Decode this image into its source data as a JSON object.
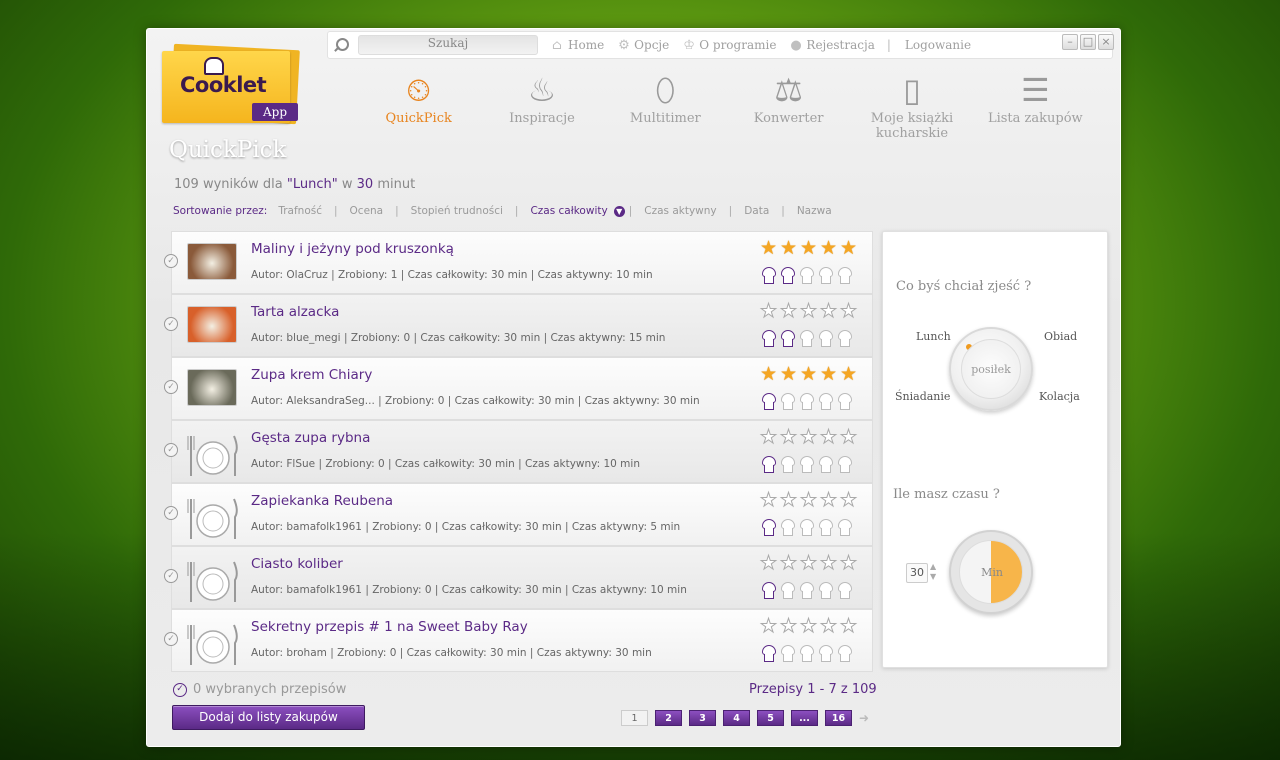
{
  "window": {
    "search_placeholder": "Szukaj",
    "links": [
      {
        "label": "Home",
        "icon": "home-icon"
      },
      {
        "label": "Opcje",
        "icon": "gear-icon"
      },
      {
        "label": "O programie",
        "icon": "chef-hat-icon"
      },
      {
        "label": "Rejestracja",
        "icon": "user-icon"
      }
    ],
    "separator": "|",
    "logout": "Logowanie"
  },
  "logo": {
    "name": "Cooklet",
    "badge": "App"
  },
  "nav": [
    {
      "label": "QuickPick",
      "icon": "quickpick-clock-icon",
      "active": true
    },
    {
      "label": "Inspiracje",
      "icon": "pot-icon",
      "active": false
    },
    {
      "label": "Multitimer",
      "icon": "egg-timer-icon",
      "active": false
    },
    {
      "label": "Konwerter",
      "icon": "scale-icon",
      "active": false
    },
    {
      "label": "Moje książki kucharskie",
      "icon": "cookbook-icon",
      "active": false
    },
    {
      "label": "Lista zakupów",
      "icon": "shopping-list-icon",
      "active": false
    }
  ],
  "page_title": "QuickPick",
  "results": {
    "count": "109 wyników dla",
    "query": "\"Lunch\"",
    "in": "w",
    "minutes": "30",
    "unit": "minut"
  },
  "sort": {
    "label": "Sortowanie przez:",
    "options": [
      "Trafność",
      "Ocena",
      "Stopień trudności",
      "Czas całkowity",
      "Czas aktywny",
      "Data",
      "Nazwa"
    ],
    "active": "Czas całkowity"
  },
  "recipes": [
    {
      "title": "Maliny i jeżyny pod kruszonką",
      "meta": "Autor: OlaCruz   | Zrobiony: 1 | Czas całkowity:  30 min   | Czas aktywny:  10 min",
      "stars": 5,
      "hats": 2,
      "thumb": "photo",
      "thumb_color": "#8a5a3a"
    },
    {
      "title": "Tarta alzacka",
      "meta": "Autor: blue_megi   | Zrobiony: 0 | Czas całkowity:  30 min   | Czas aktywny:  15 min",
      "stars": 0,
      "hats": 2,
      "thumb": "photo",
      "thumb_color": "#d8602a"
    },
    {
      "title": "Zupa krem Chiary",
      "meta": "Autor: AleksandraSeg...   | Zrobiony: 0 | Czas całkowity:  30 min   | Czas aktywny:  30 min",
      "stars": 5,
      "hats": 1,
      "thumb": "photo",
      "thumb_color": "#6a6a5a"
    },
    {
      "title": "Gęsta zupa rybna",
      "meta": "Autor: FlSue   | Zrobiony: 0 | Czas całkowity:  30 min   | Czas aktywny:  10 min",
      "stars": 0,
      "hats": 1,
      "thumb": "plate"
    },
    {
      "title": "Zapiekanka Reubena",
      "meta": "Autor: bamafolk1961   | Zrobiony: 0 | Czas całkowity:  30 min   | Czas aktywny:  5 min",
      "stars": 0,
      "hats": 1,
      "thumb": "plate"
    },
    {
      "title": "Ciasto koliber",
      "meta": "Autor: bamafolk1961   | Zrobiony: 0 | Czas całkowity:  30 min   | Czas aktywny:  10 min",
      "stars": 0,
      "hats": 1,
      "thumb": "plate"
    },
    {
      "title": "Sekretny przepis # 1 na Sweet Baby Ray",
      "meta": "Autor: broham   | Zrobiony: 0 | Czas całkowity:  30 min   | Czas aktywny:  30 min",
      "stars": 0,
      "hats": 1,
      "thumb": "plate"
    }
  ],
  "panel": {
    "meal_question": "Co byś chciał zjeść ?",
    "meal_options": {
      "lunch": "Lunch",
      "obiad": "Obiad",
      "sniadanie": "Śniadanie",
      "kolacja": "Kolacja"
    },
    "meal_dial": "posiłek",
    "time_question": "Ile masz czasu ?",
    "time_value": "30",
    "time_unit": "Min",
    "time_fill_fraction": 0.5
  },
  "footer": {
    "selected": "0 wybranych przepisów",
    "add_button": "Dodaj do listy zakupów",
    "range": "Przepisy 1 - 7 z 109",
    "pages": [
      "1",
      "2",
      "3",
      "4",
      "5",
      "...",
      "16"
    ],
    "current_page": "1"
  },
  "colors": {
    "accent": "#5b2a86",
    "active_nav": "#e8841e",
    "star": "#f5a623"
  }
}
